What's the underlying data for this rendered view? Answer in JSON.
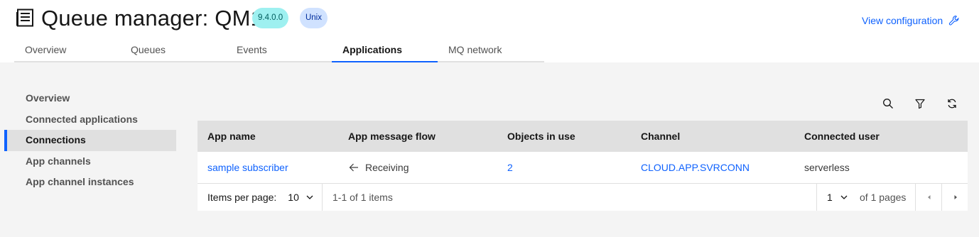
{
  "header": {
    "title": "Queue manager: QM1",
    "version_tag": "9.4.0.0",
    "platform_tag": "Unix",
    "view_config_label": "View configuration"
  },
  "tabs": [
    {
      "label": "Overview",
      "active": false
    },
    {
      "label": "Queues",
      "active": false
    },
    {
      "label": "Events",
      "active": false
    },
    {
      "label": "Applications",
      "active": true
    },
    {
      "label": "MQ network",
      "active": false
    }
  ],
  "sidenav": {
    "items": [
      {
        "label": "Overview",
        "active": false
      },
      {
        "label": "Connected applications",
        "active": false
      },
      {
        "label": "Connections",
        "active": true
      },
      {
        "label": "App channels",
        "active": false
      },
      {
        "label": "App channel instances",
        "active": false
      }
    ]
  },
  "toolbar": {
    "icons": [
      "search-icon",
      "filter-icon",
      "refresh-icon"
    ]
  },
  "table": {
    "columns": [
      "App name",
      "App message flow",
      "Objects in use",
      "Channel",
      "Connected user"
    ],
    "rows": [
      {
        "app_name": "sample subscriber",
        "message_flow": "Receiving",
        "objects_in_use": "2",
        "channel": "CLOUD.APP.SVRCONN",
        "connected_user": "serverless"
      }
    ]
  },
  "pagination": {
    "items_per_page_label": "Items per page:",
    "items_per_page_value": "10",
    "range_text": "1-1 of 1 items",
    "current_page": "1",
    "of_pages_text": "of 1 pages"
  },
  "colors": {
    "accent": "#0f62fe",
    "version_tag_bg": "#9ef0f0",
    "platform_tag_bg": "#d0e2ff",
    "content_bg": "#f4f4f4",
    "table_header_bg": "#e0e0e0"
  }
}
